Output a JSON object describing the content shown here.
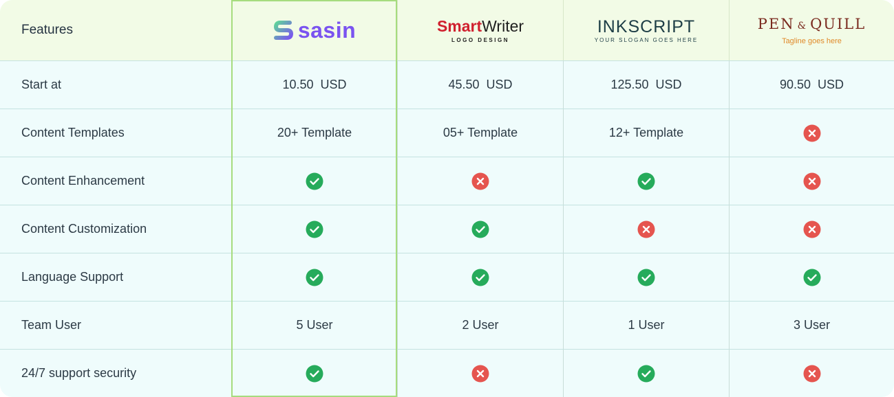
{
  "header": {
    "features_label": "Features",
    "brands": {
      "sasin": {
        "name": "sasin",
        "color": "#7a53f0"
      },
      "smartwriter": {
        "name_part1": "Smart",
        "name_part2": "Writer",
        "tagline": "LOGO DESIGN"
      },
      "inkscript": {
        "name": "INKSCRIPT",
        "tagline": "YOUR SLOGAN GOES HERE"
      },
      "penquill": {
        "name_left": "PEN",
        "name_amp": "&",
        "name_right": "QUILL",
        "tagline": "Tagline goes here"
      }
    }
  },
  "rows": [
    {
      "feature": "Start at",
      "c1": "10.50  USD",
      "c2": "45.50  USD",
      "c3": "125.50  USD",
      "c4": "90.50  USD"
    },
    {
      "feature": "Content Templates",
      "c1": "20+ Template",
      "c2": "05+ Template",
      "c3": "12+ Template",
      "c4": "x"
    },
    {
      "feature": "Content Enhancement",
      "c1": "check",
      "c2": "x",
      "c3": "check",
      "c4": "x"
    },
    {
      "feature": "Content Customization",
      "c1": "check",
      "c2": "check",
      "c3": "x",
      "c4": "x"
    },
    {
      "feature": "Language Support",
      "c1": "check",
      "c2": "check",
      "c3": "check",
      "c4": "check"
    },
    {
      "feature": "Team User",
      "c1": "5 User",
      "c2": "2 User",
      "c3": "1 User",
      "c4": "3 User"
    },
    {
      "feature": "24/7 support security",
      "c1": "check",
      "c2": "x",
      "c3": "check",
      "c4": "x"
    }
  ],
  "colors": {
    "check": "#26ab5b",
    "cross": "#e5554f",
    "highlight_border": "#a6dc7e"
  }
}
